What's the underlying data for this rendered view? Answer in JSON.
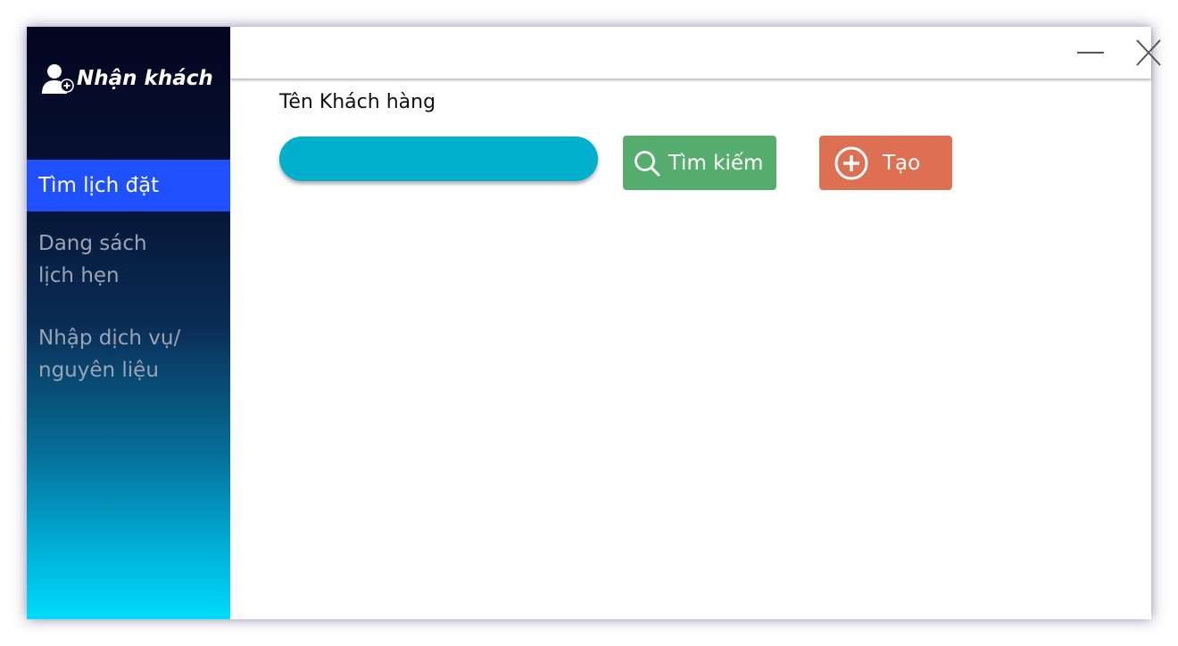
{
  "sidebar": {
    "title": "Nhận khách",
    "brand_icon": "add-user-icon",
    "items": [
      {
        "lines": [
          "Tìm lịch đặt"
        ],
        "active": true
      },
      {
        "lines": [
          "Dang sách",
          "lịch hẹn"
        ],
        "active": false
      },
      {
        "lines": [
          "Nhập dịch vụ/",
          "nguyên liệu"
        ],
        "active": false
      }
    ],
    "active_color": "#1e50ff"
  },
  "titlebar": {
    "minimize_icon": "minimize-icon",
    "close_icon": "close-icon"
  },
  "form": {
    "name_label": "Tên Khách hàng",
    "name_value": "",
    "search_button_label": "Tìm kiếm",
    "search_button_icon": "search-icon",
    "create_button_label": "Tạo",
    "create_button_icon": "add-circle-icon"
  },
  "colors": {
    "input": "#00afcc",
    "search_button": "#56ae6e",
    "create_button": "#dd6f53"
  }
}
